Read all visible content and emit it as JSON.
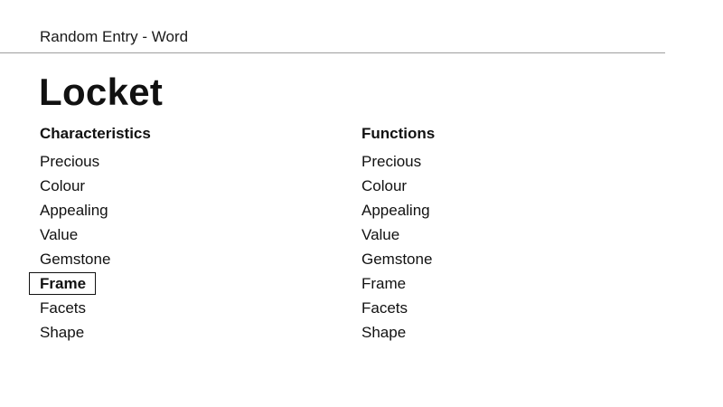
{
  "header": {
    "title": "Random Entry - Word"
  },
  "entry": {
    "word": "Locket"
  },
  "characteristics": {
    "heading": "Characteristics",
    "items": [
      "Precious",
      "Colour",
      "Appealing",
      "Value",
      "Gemstone",
      "Frame",
      "Facets",
      "Shape"
    ],
    "selected": "Frame"
  },
  "functions": {
    "heading": "Functions",
    "items": [
      "Precious",
      "Colour",
      "Appealing",
      "Value",
      "Gemstone",
      "Frame",
      "Facets",
      "Shape"
    ]
  }
}
